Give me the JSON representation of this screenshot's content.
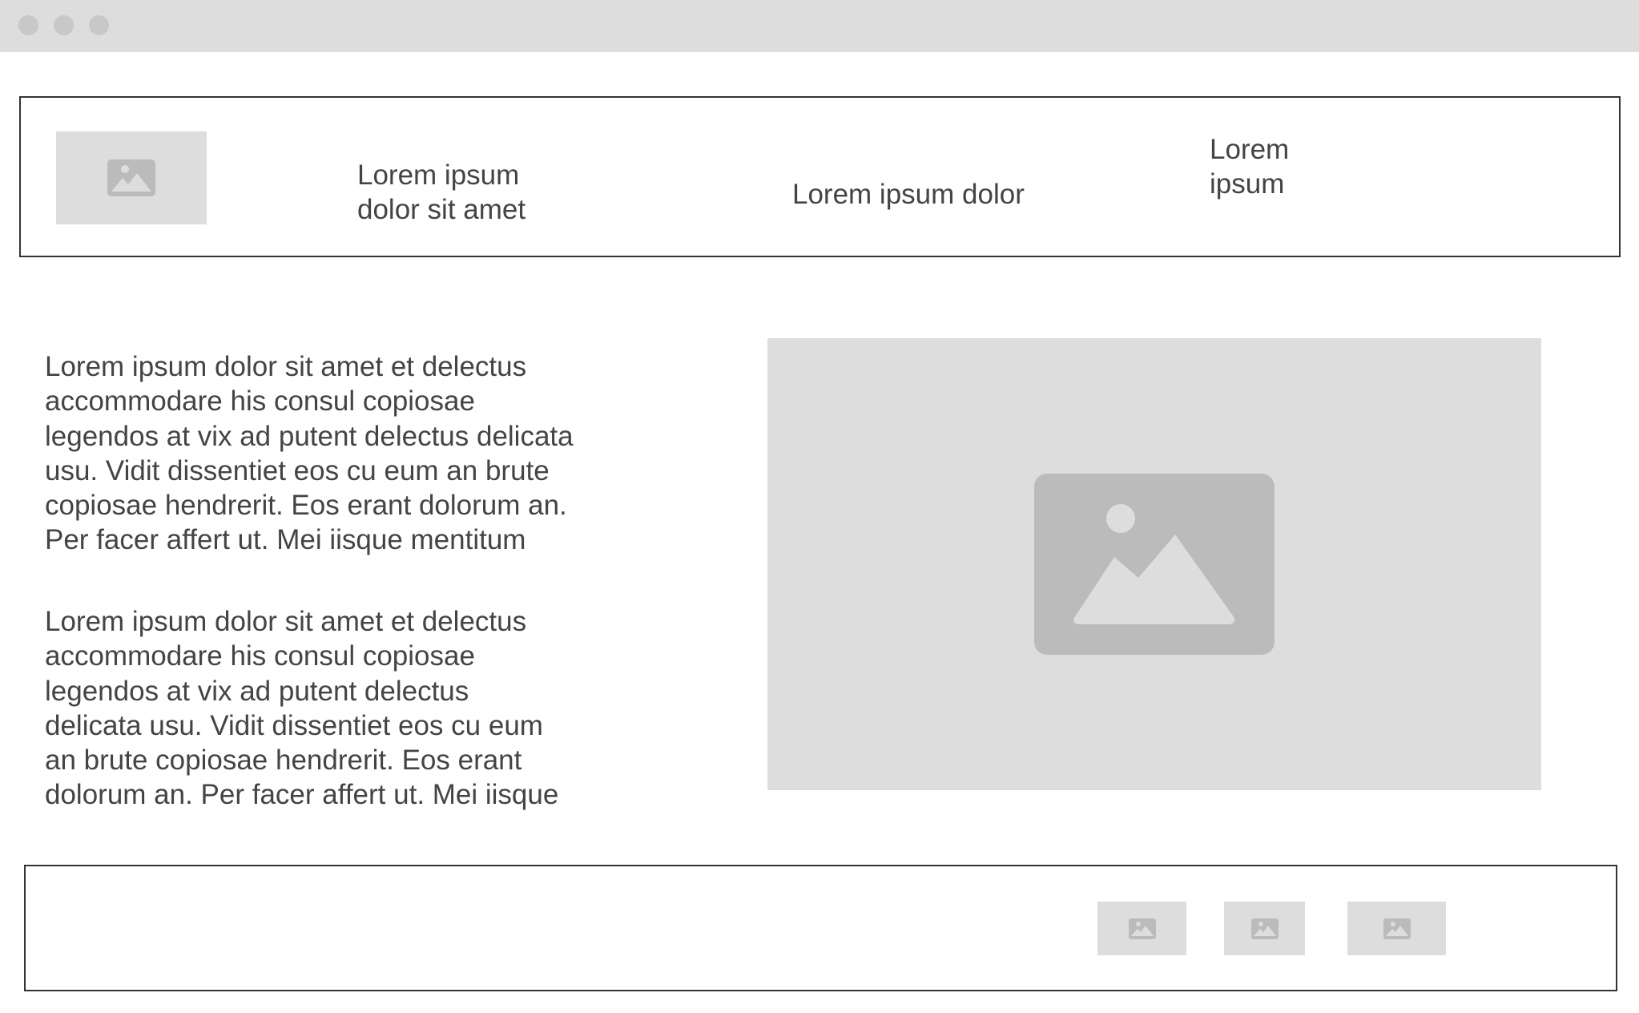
{
  "window": {
    "controls": [
      "window-dot",
      "window-dot",
      "window-dot"
    ]
  },
  "header": {
    "logo_icon": "image-icon",
    "nav": [
      {
        "label": "Lorem ipsum\ndolor sit amet"
      },
      {
        "label": "Lorem ipsum dolor"
      },
      {
        "label": "Lorem\nipsum"
      }
    ]
  },
  "main": {
    "paragraphs": [
      "Lorem ipsum dolor sit amet et delectus\naccommodare his consul copiosae\nlegendos at vix ad putent delectus delicata\nusu. Vidit dissentiet eos cu eum an brute\ncopiosae hendrerit. Eos erant dolorum an.\nPer facer affert ut. Mei iisque mentitum",
      "Lorem ipsum dolor sit amet et delectus\naccommodare his consul copiosae\nlegendos at vix ad putent delectus\ndelicata usu. Vidit dissentiet eos cu eum\nan brute copiosae hendrerit. Eos erant\ndolorum an. Per facer affert ut. Mei iisque"
    ],
    "hero_icon": "image-icon"
  },
  "footer": {
    "icons": [
      "image-icon",
      "image-icon",
      "image-icon"
    ]
  },
  "colors": {
    "placeholder_bg": "#dddddd",
    "icon_fill": "#bbbbbb",
    "text": "#444444",
    "border": "#333333",
    "titlebar": "#dddddd"
  }
}
